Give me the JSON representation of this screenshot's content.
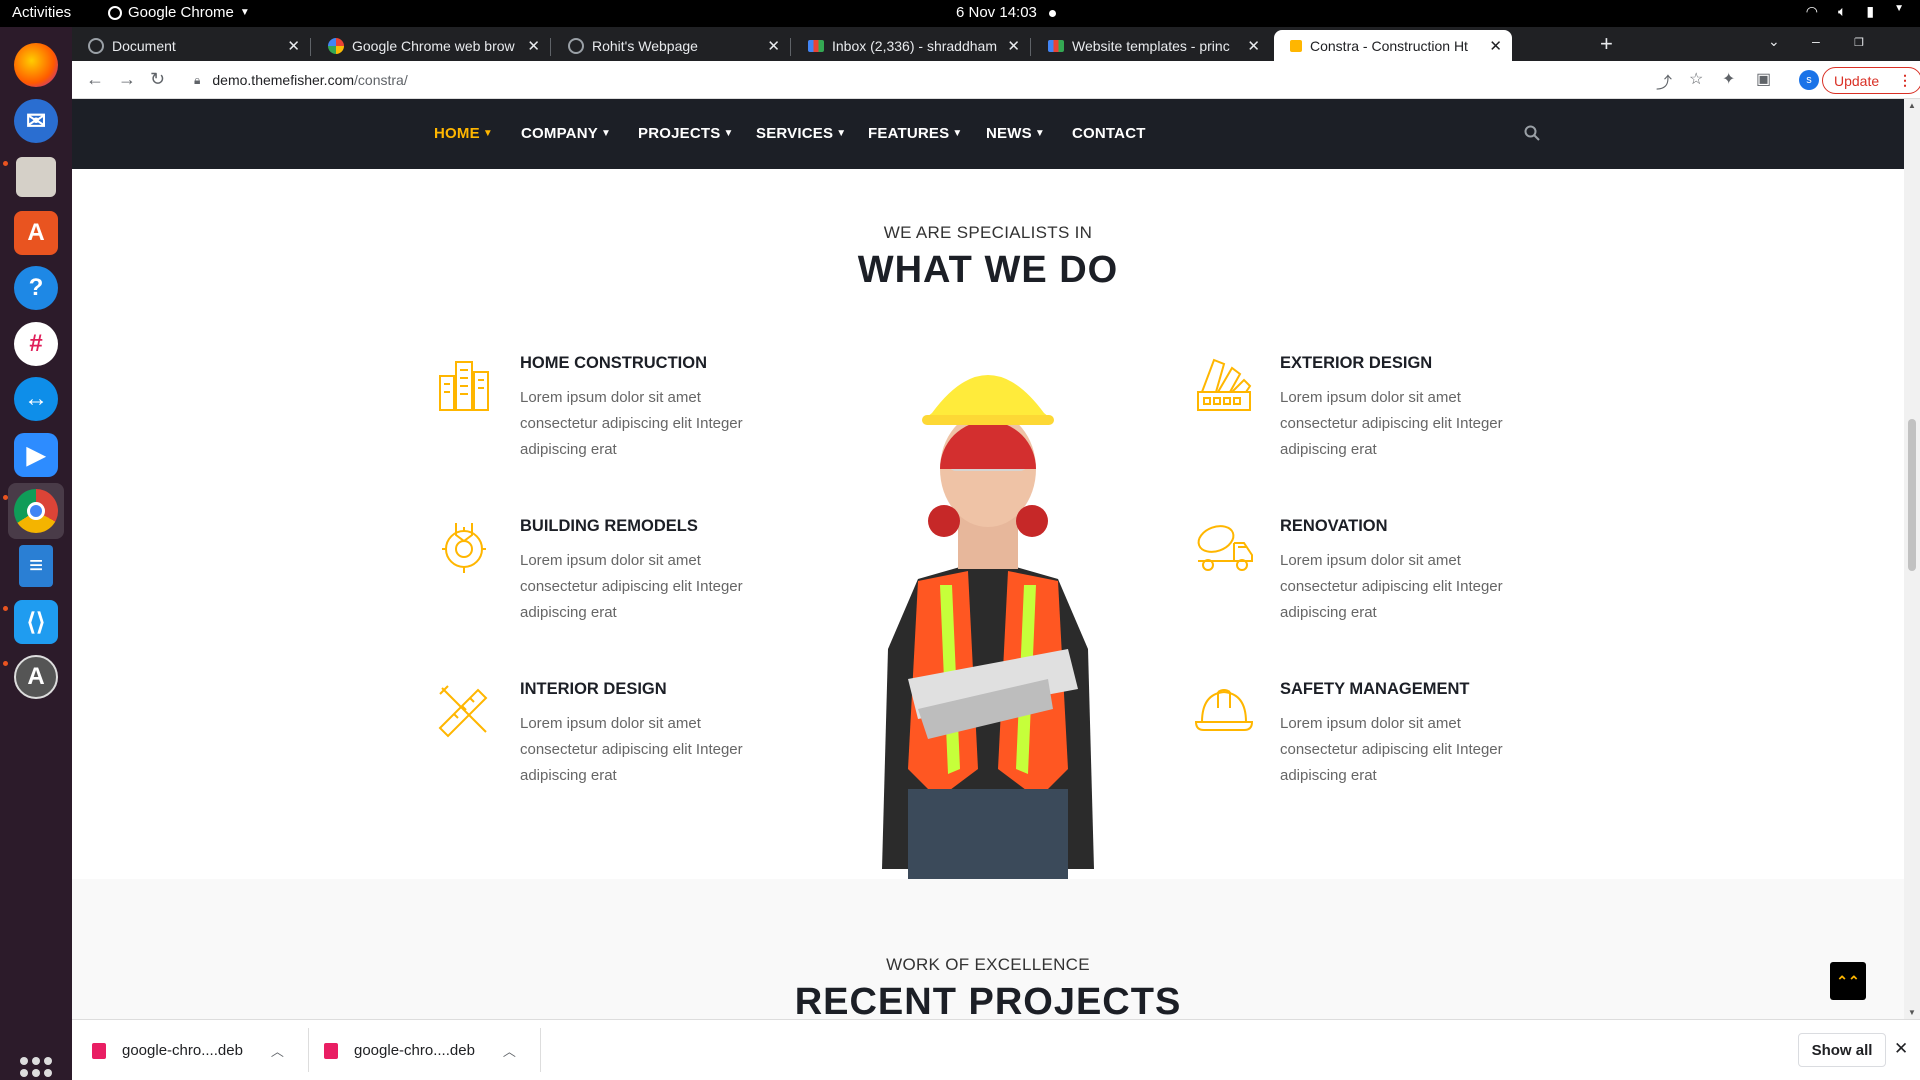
{
  "system": {
    "activities": "Activities",
    "app_menu": "Google Chrome",
    "clock": "6 Nov  14:03"
  },
  "dock": {
    "apps": [
      "firefox",
      "thunderbird",
      "files",
      "software-center",
      "help",
      "slack",
      "teamviewer",
      "zoom",
      "chrome",
      "libreoffice-writer",
      "vscode",
      "software-updater"
    ]
  },
  "browser": {
    "tabs": [
      {
        "title": "Document"
      },
      {
        "title": "Google Chrome web brow"
      },
      {
        "title": "Rohit's Webpage"
      },
      {
        "title": "Inbox (2,336) - shraddham"
      },
      {
        "title": "Website templates - princ"
      },
      {
        "title": "Constra - Construction Ht"
      }
    ],
    "url_host": "demo.themefisher.com",
    "url_path": "/constra/",
    "update_label": "Update",
    "profile_initial": "s"
  },
  "site": {
    "menu": [
      {
        "label": "HOME"
      },
      {
        "label": "COMPANY"
      },
      {
        "label": "PROJECTS"
      },
      {
        "label": "SERVICES"
      },
      {
        "label": "FEATURES"
      },
      {
        "label": "NEWS"
      },
      {
        "label": "CONTACT"
      }
    ],
    "section_sub": "WE ARE SPECIALISTS IN",
    "section_title": "WHAT WE DO",
    "services_left": [
      {
        "title": "HOME CONSTRUCTION",
        "text": "Lorem ipsum dolor sit amet consectetur adipiscing elit Integer adipiscing erat",
        "icon": "building-icon"
      },
      {
        "title": "BUILDING REMODELS",
        "text": "Lorem ipsum dolor sit amet consectetur adipiscing elit Integer adipiscing erat",
        "icon": "gear-wrench-icon"
      },
      {
        "title": "INTERIOR DESIGN",
        "text": "Lorem ipsum dolor sit amet consectetur adipiscing elit Integer adipiscing erat",
        "icon": "ruler-pencil-icon"
      }
    ],
    "services_right": [
      {
        "title": "EXTERIOR DESIGN",
        "text": "Lorem ipsum dolor sit amet consectetur adipiscing elit Integer adipiscing erat",
        "icon": "color-swatch-icon"
      },
      {
        "title": "RENOVATION",
        "text": "Lorem ipsum dolor sit amet consectetur adipiscing elit Integer adipiscing erat",
        "icon": "cement-truck-icon"
      },
      {
        "title": "SAFETY MANAGEMENT",
        "text": "Lorem ipsum dolor sit amet consectetur adipiscing elit Integer adipiscing erat",
        "icon": "hard-hat-icon"
      }
    ],
    "next_sub": "WORK OF EXCELLENCE",
    "next_title": "RECENT PROJECTS",
    "accent_color": "#ffb600",
    "nav_bg": "#1c1f26"
  },
  "downloads": {
    "items": [
      {
        "name": "google-chro....deb"
      },
      {
        "name": "google-chro....deb"
      }
    ],
    "show_all": "Show all"
  }
}
